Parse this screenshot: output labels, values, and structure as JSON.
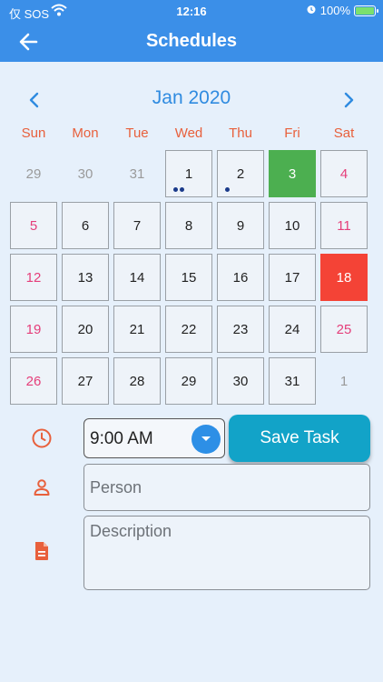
{
  "status_bar": {
    "carrier": "仅 SOS",
    "time": "12:16",
    "battery": "100%"
  },
  "header": {
    "title": "Schedules",
    "back_icon": "arrow-left-icon"
  },
  "calendar": {
    "month_label": "Jan 2020",
    "weekdays": [
      "Sun",
      "Mon",
      "Tue",
      "Wed",
      "Thu",
      "Fri",
      "Sat"
    ],
    "days": [
      {
        "label": "29",
        "kind": "other"
      },
      {
        "label": "30",
        "kind": "other"
      },
      {
        "label": "31",
        "kind": "other"
      },
      {
        "label": "1",
        "kind": "normal",
        "dots": 2
      },
      {
        "label": "2",
        "kind": "normal",
        "dots": 1
      },
      {
        "label": "3",
        "kind": "today"
      },
      {
        "label": "4",
        "kind": "weekend"
      },
      {
        "label": "5",
        "kind": "weekend"
      },
      {
        "label": "6",
        "kind": "normal"
      },
      {
        "label": "7",
        "kind": "normal"
      },
      {
        "label": "8",
        "kind": "normal"
      },
      {
        "label": "9",
        "kind": "normal"
      },
      {
        "label": "10",
        "kind": "normal"
      },
      {
        "label": "11",
        "kind": "weekend"
      },
      {
        "label": "12",
        "kind": "weekend"
      },
      {
        "label": "13",
        "kind": "normal"
      },
      {
        "label": "14",
        "kind": "normal"
      },
      {
        "label": "15",
        "kind": "normal"
      },
      {
        "label": "16",
        "kind": "normal"
      },
      {
        "label": "17",
        "kind": "normal"
      },
      {
        "label": "18",
        "kind": "selected"
      },
      {
        "label": "19",
        "kind": "weekend"
      },
      {
        "label": "20",
        "kind": "normal"
      },
      {
        "label": "21",
        "kind": "normal"
      },
      {
        "label": "22",
        "kind": "normal"
      },
      {
        "label": "23",
        "kind": "normal"
      },
      {
        "label": "24",
        "kind": "normal"
      },
      {
        "label": "25",
        "kind": "weekend"
      },
      {
        "label": "26",
        "kind": "weekend"
      },
      {
        "label": "27",
        "kind": "normal"
      },
      {
        "label": "28",
        "kind": "normal"
      },
      {
        "label": "29",
        "kind": "normal"
      },
      {
        "label": "30",
        "kind": "normal"
      },
      {
        "label": "31",
        "kind": "normal"
      },
      {
        "label": "1",
        "kind": "other"
      }
    ]
  },
  "form": {
    "time_value": "9:00 AM",
    "save_label": "Save Task",
    "person_placeholder": "Person",
    "description_placeholder": "Description",
    "icons": {
      "time": "clock-icon",
      "person": "person-icon",
      "description": "document-icon"
    }
  },
  "colors": {
    "header": "#3b8fe8",
    "accent_orange": "#e8603c",
    "today": "#4caf50",
    "selected": "#f44336",
    "save_button": "#12a3c8",
    "weekend": "#e53e7a"
  }
}
